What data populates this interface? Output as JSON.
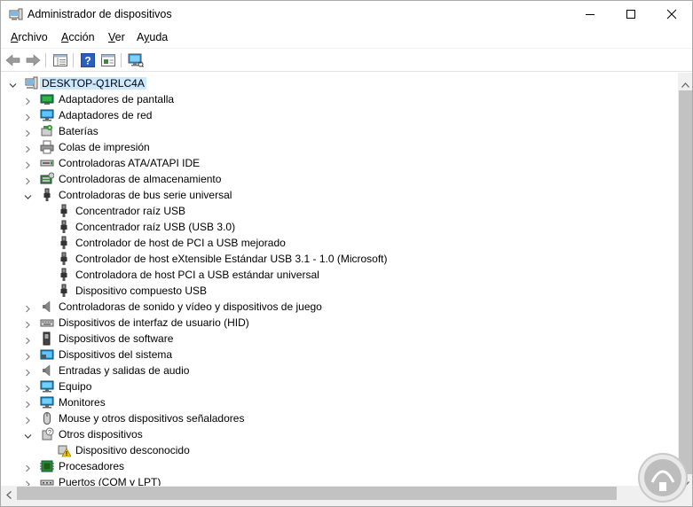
{
  "window": {
    "title": "Administrador de dispositivos"
  },
  "menu": {
    "items": [
      {
        "label": "Archivo",
        "accel": "A",
        "rest": "rchivo"
      },
      {
        "label": "Acción",
        "accel": "A",
        "rest": "cción"
      },
      {
        "label": "Ver",
        "accel": "V",
        "rest": "er"
      },
      {
        "label": "Ayuda",
        "accel": "y",
        "pre": "A",
        "rest": "uda"
      }
    ]
  },
  "toolbar": {
    "buttons": [
      "back-icon",
      "forward-icon",
      "properties-list-icon",
      "help-icon",
      "properties-icon",
      "scan-hardware-icon"
    ]
  },
  "tree": {
    "root": "DESKTOP-Q1RLC4A",
    "items": [
      {
        "label": "Adaptadores de pantalla",
        "icon": "display-adapter-icon",
        "level": 1,
        "expand": "collapsed"
      },
      {
        "label": "Adaptadores de red",
        "icon": "network-adapter-icon",
        "level": 1,
        "expand": "collapsed"
      },
      {
        "label": "Baterías",
        "icon": "battery-icon",
        "level": 1,
        "expand": "collapsed"
      },
      {
        "label": "Colas de impresión",
        "icon": "printer-icon",
        "level": 1,
        "expand": "collapsed"
      },
      {
        "label": "Controladoras ATA/ATAPI IDE",
        "icon": "ide-controller-icon",
        "level": 1,
        "expand": "collapsed"
      },
      {
        "label": "Controladoras de almacenamiento",
        "icon": "storage-controller-icon",
        "level": 1,
        "expand": "collapsed"
      },
      {
        "label": "Controladoras de bus serie universal",
        "icon": "usb-icon",
        "level": 1,
        "expand": "expanded"
      },
      {
        "label": "Concentrador raíz USB",
        "icon": "usb-icon",
        "level": 2,
        "expand": "none"
      },
      {
        "label": "Concentrador raíz USB (USB 3.0)",
        "icon": "usb-icon",
        "level": 2,
        "expand": "none"
      },
      {
        "label": "Controlador de host de PCI a USB mejorado",
        "icon": "usb-icon",
        "level": 2,
        "expand": "none"
      },
      {
        "label": "Controlador de host eXtensible Estándar USB 3.1 - 1.0 (Microsoft)",
        "icon": "usb-icon",
        "level": 2,
        "expand": "none"
      },
      {
        "label": "Controladora de host PCI a USB estándar universal",
        "icon": "usb-icon",
        "level": 2,
        "expand": "none"
      },
      {
        "label": "Dispositivo compuesto USB",
        "icon": "usb-icon",
        "level": 2,
        "expand": "none"
      },
      {
        "label": "Controladoras de sonido y vídeo y dispositivos de juego",
        "icon": "speaker-icon",
        "level": 1,
        "expand": "collapsed"
      },
      {
        "label": "Dispositivos de interfaz de usuario (HID)",
        "icon": "hid-icon",
        "level": 1,
        "expand": "collapsed"
      },
      {
        "label": "Dispositivos de software",
        "icon": "software-device-icon",
        "level": 1,
        "expand": "collapsed"
      },
      {
        "label": "Dispositivos del sistema",
        "icon": "system-device-icon",
        "level": 1,
        "expand": "collapsed"
      },
      {
        "label": "Entradas y salidas de audio",
        "icon": "speaker-icon",
        "level": 1,
        "expand": "collapsed"
      },
      {
        "label": "Equipo",
        "icon": "computer-icon",
        "level": 1,
        "expand": "collapsed"
      },
      {
        "label": "Monitores",
        "icon": "monitor-icon",
        "level": 1,
        "expand": "collapsed"
      },
      {
        "label": "Mouse y otros dispositivos señaladores",
        "icon": "mouse-icon",
        "level": 1,
        "expand": "collapsed"
      },
      {
        "label": "Otros dispositivos",
        "icon": "unknown-device-icon",
        "level": 1,
        "expand": "expanded"
      },
      {
        "label": "Dispositivo desconocido",
        "icon": "warning-device-icon",
        "level": 2,
        "expand": "none"
      },
      {
        "label": "Procesadores",
        "icon": "processor-icon",
        "level": 1,
        "expand": "collapsed"
      },
      {
        "label": "Puertos (COM y LPT)",
        "icon": "port-icon",
        "level": 1,
        "expand": "collapsed"
      }
    ]
  },
  "colors": {
    "selection": "#cce8ff",
    "accent": "#0078d7"
  }
}
